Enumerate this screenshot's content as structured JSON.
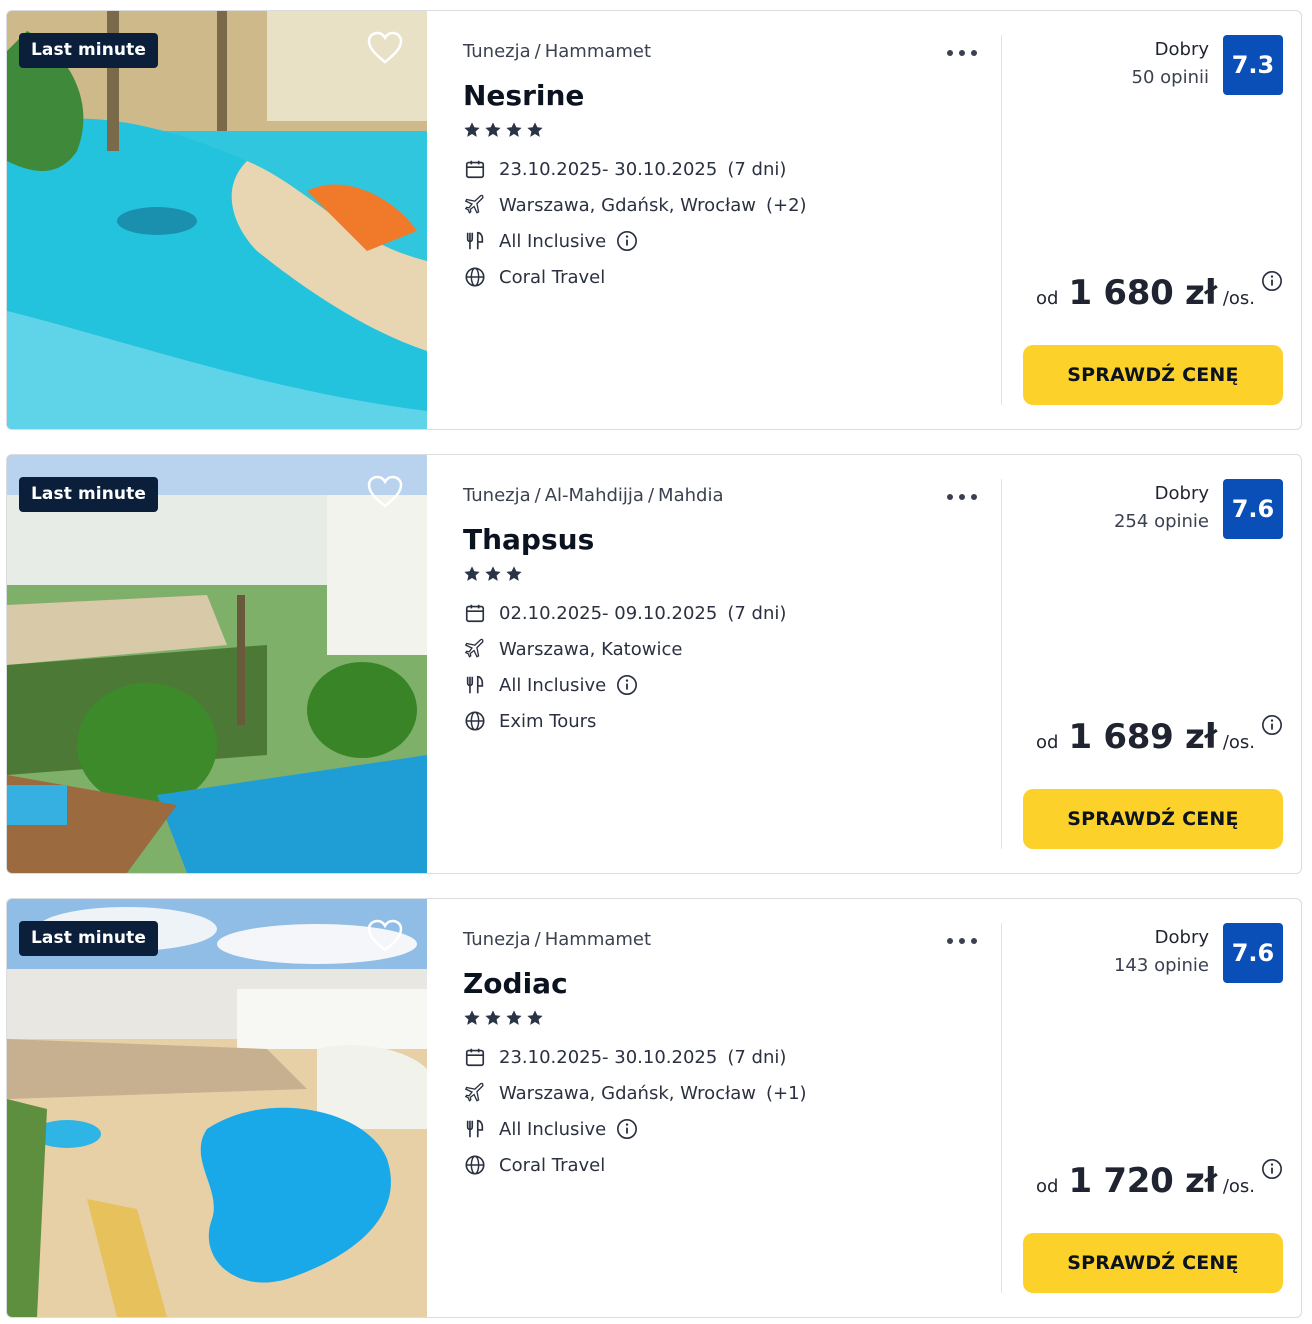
{
  "colors": {
    "badge_bg": "#0b1f3a",
    "score_bg": "#0a4fb8",
    "cta_bg": "#fcd12a",
    "border": "#d9dce1"
  },
  "offers": [
    {
      "badge": "Last minute",
      "breadcrumb": [
        "Tunezja",
        "Hammamet"
      ],
      "name": "Nesrine",
      "stars": 4,
      "dates": "23.10.2025- 30.10.2025",
      "duration": "(7 dni)",
      "departures": "Warszawa, Gdańsk, Wrocław",
      "departures_extra": "(+2)",
      "board": "All Inclusive",
      "operator": "Coral Travel",
      "rating_label": "Dobry",
      "rating_count": "50 opinii",
      "score": "7.3",
      "price_prefix": "od",
      "price": "1 680 zł",
      "price_suffix": "/os.",
      "cta": "SPRAWDŹ CENĘ",
      "image": "pool-resort-icon"
    },
    {
      "badge": "Last minute",
      "breadcrumb": [
        "Tunezja",
        "Al-Mahdijja",
        "Mahdia"
      ],
      "name": "Thapsus",
      "stars": 3,
      "dates": "02.10.2025- 09.10.2025",
      "duration": "(7 dni)",
      "departures": "Warszawa, Katowice",
      "departures_extra": "",
      "board": "All Inclusive",
      "operator": "Exim Tours",
      "rating_label": "Dobry",
      "rating_count": "254 opinie",
      "score": "7.6",
      "price_prefix": "od",
      "price": "1 689 zł",
      "price_suffix": "/os.",
      "cta": "SPRAWDŹ CENĘ",
      "image": "garden-resort-icon"
    },
    {
      "badge": "Last minute",
      "breadcrumb": [
        "Tunezja",
        "Hammamet"
      ],
      "name": "Zodiac",
      "stars": 4,
      "dates": "23.10.2025- 30.10.2025",
      "duration": "(7 dni)",
      "departures": "Warszawa, Gdańsk, Wrocław",
      "departures_extra": "(+1)",
      "board": "All Inclusive",
      "operator": "Coral Travel",
      "rating_label": "Dobry",
      "rating_count": "143 opinie",
      "score": "7.6",
      "price_prefix": "od",
      "price": "1 720 zł",
      "price_suffix": "/os.",
      "cta": "SPRAWDŹ CENĘ",
      "image": "aerial-pool-icon"
    }
  ]
}
